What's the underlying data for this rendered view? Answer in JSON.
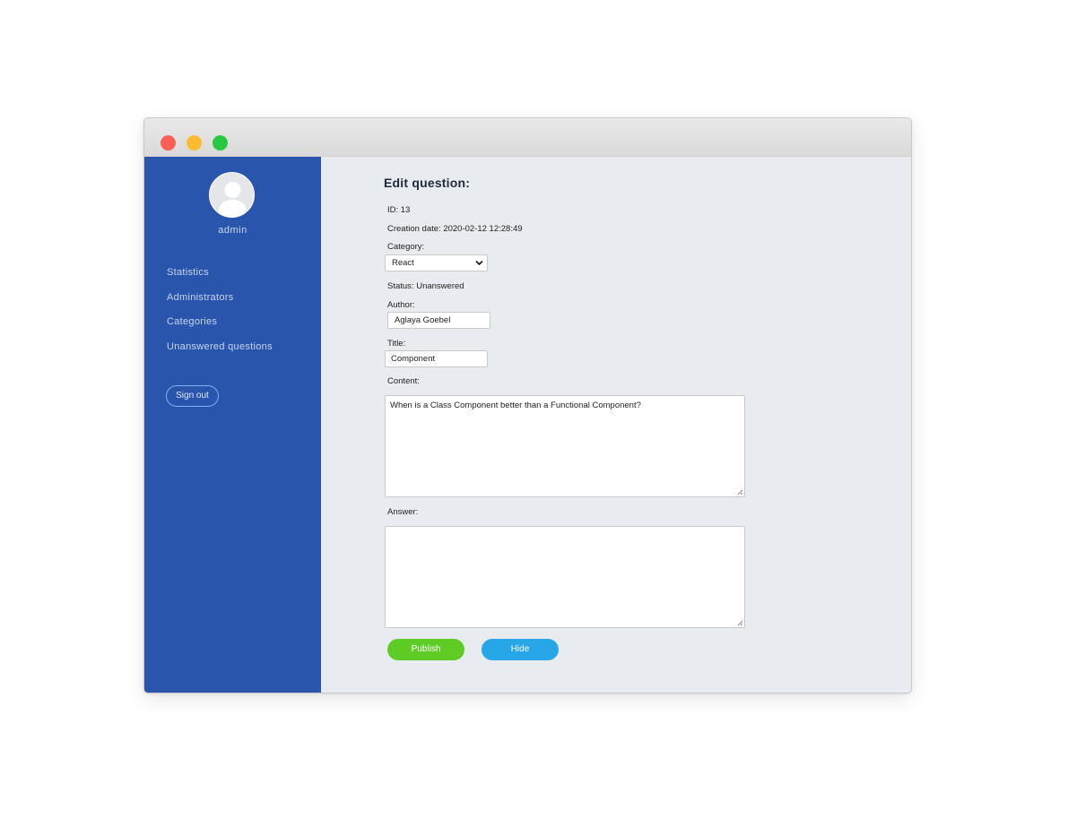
{
  "sidebar": {
    "user_name": "admin",
    "nav": [
      {
        "label": "Statistics"
      },
      {
        "label": "Administrators"
      },
      {
        "label": "Categories"
      },
      {
        "label": "Unanswered questions"
      }
    ],
    "sign_out_label": "Sign out"
  },
  "form": {
    "heading": "Edit question:",
    "id_text": "ID: 13",
    "creation_date_text": "Creation date: 2020-02-12 12:28:49",
    "category_label": "Category:",
    "category_value": "React",
    "status_text": "Status: Unanswered",
    "author_label": "Author:",
    "author_value": "Aglaya Goebel",
    "title_label": "Title:",
    "title_value": "Component",
    "content_label": "Content:",
    "content_value": "When is a Class Component better than a Functional Component?",
    "answer_label": "Answer:",
    "answer_value": "",
    "publish_label": "Publish",
    "hide_label": "Hide"
  },
  "colors": {
    "sidebar_bg": "#2a55ad",
    "main_bg": "#e8ecf0",
    "publish_button": "#5fcc26",
    "hide_button": "#28a7e8",
    "traffic_red": "#fd5f57",
    "traffic_yellow": "#fcbc2e",
    "traffic_green": "#28c840"
  }
}
